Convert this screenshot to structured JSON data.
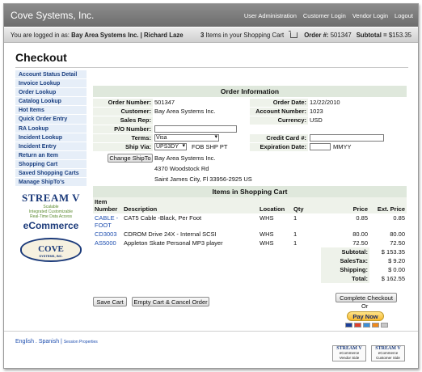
{
  "header": {
    "brand": "Cove Systems, Inc.",
    "nav": [
      "User Administration",
      "Customer Login",
      "Vendor Login",
      "Logout"
    ]
  },
  "status": {
    "logged_in_prefix": "You are logged in as:",
    "account": "Bay Area Systems Inc. | Richard Laze",
    "cart_count": "3",
    "cart_text": "Items in your Shopping Cart",
    "order_label": "Order #:",
    "order_number": "501347",
    "subtotal_label": "Subtotal =",
    "subtotal_value": "$153.35"
  },
  "page_title": "Checkout",
  "sidebar": {
    "items": [
      "Account Status Detail",
      "Invoice Lookup",
      "Order Lookup",
      "Catalog Lookup",
      "Hot Items",
      "Quick Order Entry",
      "RA Lookup",
      "Incident Lookup",
      "Incident Entry",
      "Return an Item",
      "Shopping Cart",
      "Saved Shopping Carts",
      "Manage ShipTo's"
    ],
    "logo_stream": {
      "title": "STREAM V",
      "tagline1": "Scalable",
      "tagline2": "Integrated   Customizable",
      "tagline3": "Real-Time Data Access",
      "ecommerce": "eCommerce"
    },
    "logo_cove": {
      "name": "COVE",
      "sub": "SYSTEMS, INC."
    }
  },
  "order_info": {
    "title": "Order Information",
    "order_number_label": "Order Number:",
    "order_number": "501347",
    "order_date_label": "Order Date:",
    "order_date": "12/22/2010",
    "customer_label": "Customer:",
    "customer": "Bay Area Systems Inc.",
    "account_number_label": "Account Number:",
    "account_number": "1023",
    "sales_rep_label": "Sales Rep:",
    "sales_rep": "",
    "currency_label": "Currency:",
    "currency": "USD",
    "po_label": "P/O Number:",
    "po_value": "",
    "terms_label": "Terms:",
    "terms_value": "Visa",
    "credit_card_label": "Credit Card #:",
    "credit_card_value": "",
    "ship_via_label": "Ship Via:",
    "ship_via_value": "UPS3DY",
    "fob": "FOB SHP PT",
    "expiration_label": "Expiration Date:",
    "expiration_value": "",
    "expiration_format": "MMYY",
    "change_shipto_label": "Change ShipTo",
    "shipto_line1": "Bay Area Systems Inc.",
    "shipto_line2": "4370 Woodstock Rd",
    "shipto_line3": "Saint James City, Fl 33956-2925 US"
  },
  "cart": {
    "title": "Items in Shopping Cart",
    "columns": [
      "Item Number",
      "Description",
      "Location",
      "Qty",
      "Price",
      "Ext. Price"
    ],
    "rows": [
      {
        "item": "CABLE - FOOT",
        "description": "CAT5 Cable -Black, Per Foot",
        "location": "WHS",
        "qty": "1",
        "price": "0.85",
        "ext": "0.85"
      },
      {
        "item": "CD3003",
        "description": "CDROM Drive 24X - Internal SCSI",
        "location": "WHS",
        "qty": "1",
        "price": "80.00",
        "ext": "80.00"
      },
      {
        "item": "AS5000",
        "description": "Appleton Skate Personal MP3 player",
        "location": "WHS",
        "qty": "1",
        "price": "72.50",
        "ext": "72.50"
      }
    ],
    "totals": [
      {
        "label": "Subtotal:",
        "value": "$ 153.35"
      },
      {
        "label": "SalesTax:",
        "value": "$ 9.20"
      },
      {
        "label": "Shipping:",
        "value": "$ 0.00"
      },
      {
        "label": "Total:",
        "value": "$ 162.55"
      }
    ]
  },
  "actions": {
    "save_cart": "Save Cart",
    "empty_cart": "Empty Cart & Cancel Order",
    "complete_checkout": "Complete Checkout",
    "or": "Or",
    "pay_now": "Pay Now"
  },
  "footer": {
    "english": "English",
    "spanish": "Spanish",
    "session_properties": "Session Properties",
    "badge1_title": "STREAM V",
    "badge1_sub": "eCommerce",
    "badge1_role": "Vendor Side",
    "badge2_title": "STREAM V",
    "badge2_sub": "eCommerce",
    "badge2_role": "Customer Side"
  }
}
